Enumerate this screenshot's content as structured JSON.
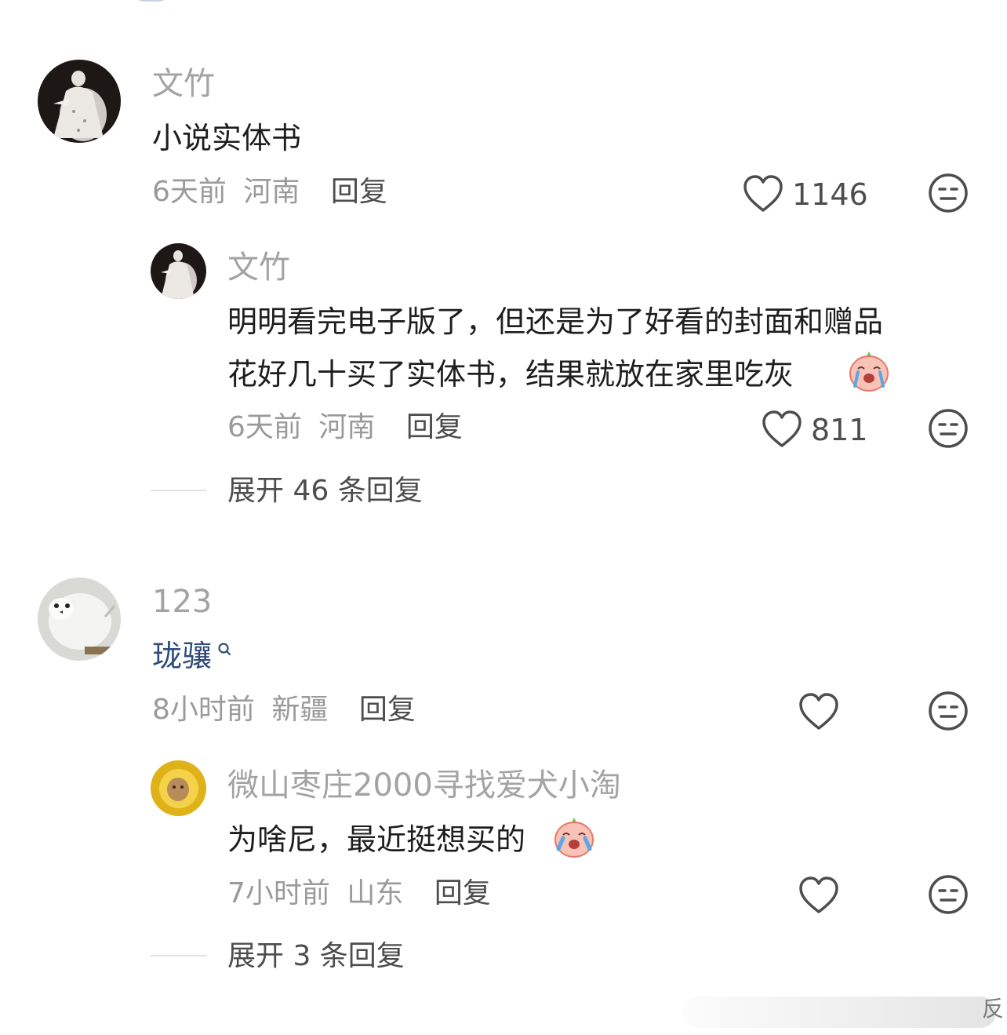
{
  "comments": [
    {
      "username": "文竹",
      "text": "小说实体书",
      "time": "6天前",
      "location": "河南",
      "reply_label": "回复",
      "likes": "1146",
      "avatar": "bride-photo-avatar",
      "replies": [
        {
          "username": "文竹",
          "text_line1": "明明看完电子版了，但还是为了好看的封面和赠品",
          "text_line2": "花好几十买了实体书，结果就放在家里吃灰",
          "emoji": "crying-peach-emoji",
          "time": "6天前",
          "location": "河南",
          "reply_label": "回复",
          "likes": "811",
          "avatar": "bride-photo-avatar"
        }
      ],
      "expand_label": "展开 46 条回复"
    },
    {
      "username": "123",
      "text": "珑骧",
      "search_icon": "search-icon",
      "time": "8小时前",
      "location": "新疆",
      "reply_label": "回复",
      "likes": "",
      "avatar": "white-bird-avatar",
      "replies": [
        {
          "username": "微山枣庄2000寻找爱犬小淘",
          "text": "为啥尼，最近挺想买的",
          "emoji": "crying-peach-emoji",
          "time": "7小时前",
          "location": "山东",
          "reply_label": "回复",
          "likes": "",
          "avatar": "yellow-toy-avatar"
        }
      ],
      "expand_label": "展开 3 条回复"
    }
  ],
  "colors": {
    "username": "#a3a3a3",
    "meta": "#9a9a9a",
    "link": "#2f4b7a",
    "emoji_peach": "#f59a8a"
  },
  "watermark": "反"
}
